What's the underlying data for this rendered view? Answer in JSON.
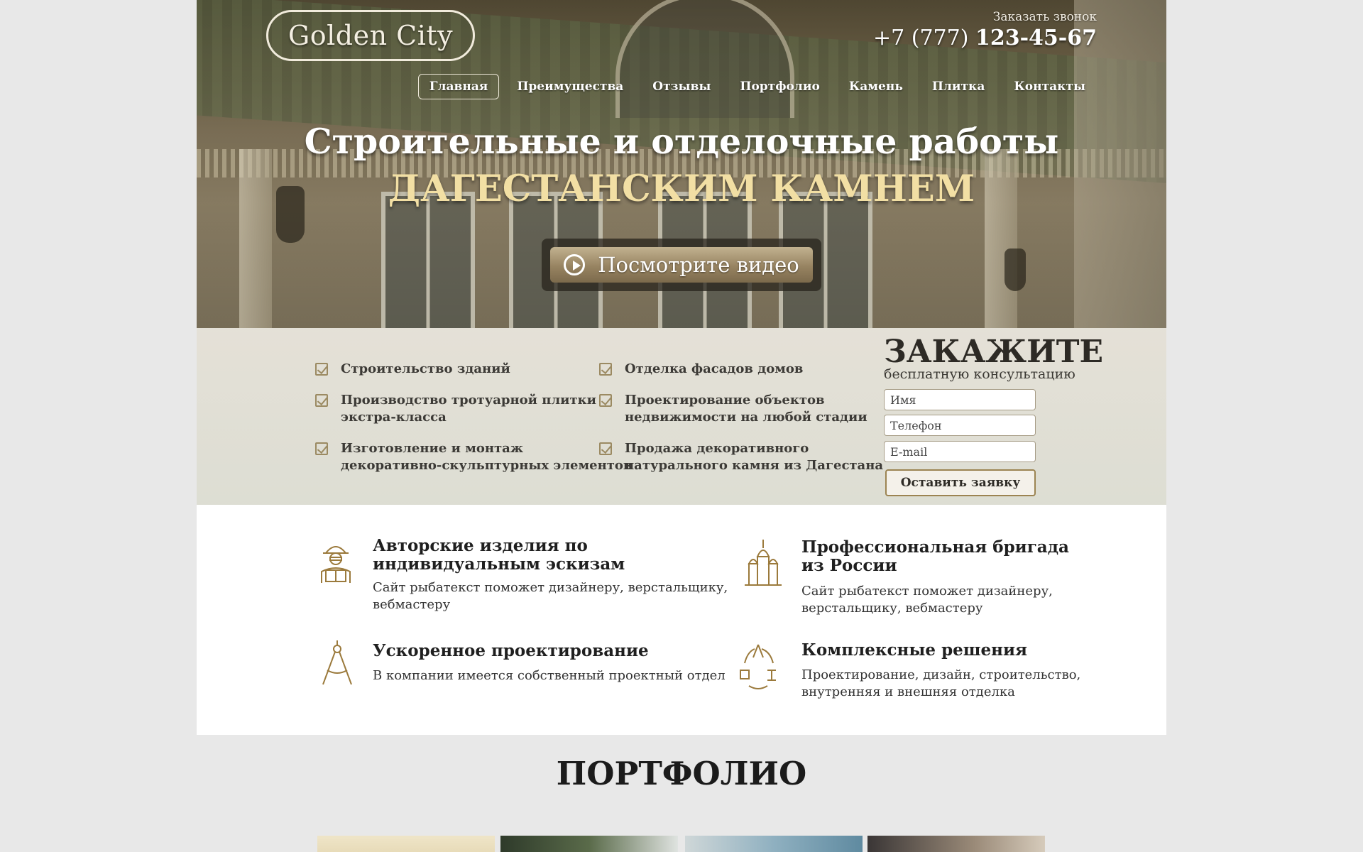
{
  "header": {
    "logo": "Golden City",
    "call_link": "Заказать звонок",
    "phone_code": "+7 (777)",
    "phone_number": "123-45-67"
  },
  "nav": {
    "items": [
      {
        "label": "Главная",
        "active": true
      },
      {
        "label": "Преимущества"
      },
      {
        "label": "Отзывы"
      },
      {
        "label": "Портфолио"
      },
      {
        "label": "Камень"
      },
      {
        "label": "Плитка"
      },
      {
        "label": "Контакты"
      }
    ]
  },
  "hero": {
    "title": "Строительные и отделочные работы",
    "subtitle": "ДАГЕСТАНСКИМ КАМНЕМ",
    "video_button": "Посмотрите видео"
  },
  "services": {
    "items": [
      {
        "line1": "Строительство зданий",
        "line2": ""
      },
      {
        "line1": "Отделка фасадов домов",
        "line2": ""
      },
      {
        "line1": "Производство тротуарной плитки",
        "line2": "экстра-класса"
      },
      {
        "line1": "Проектирование объектов",
        "line2": "недвижимости на любой стадии"
      },
      {
        "line1": "Изготовление и монтаж",
        "line2": "декоративно-скульптурных элементов"
      },
      {
        "line1": "Продажа декоративного",
        "line2": "натурального камня из Дагестана"
      }
    ]
  },
  "order_form": {
    "title": "ЗАКАЖИТЕ",
    "subtitle": "бесплатную консультацию",
    "name_placeholder": "Имя",
    "phone_placeholder": "Телефон",
    "email_placeholder": "E-mail",
    "submit_label": "Оставить заявку"
  },
  "features": {
    "items": [
      {
        "title_1": "Авторские изделия по",
        "title_2": "индивидуальным эскизам",
        "text_1": "Сайт рыбатекст поможет дизайнеру, верстальщику,",
        "text_2": "вебмастеру",
        "icon": "engineer-icon"
      },
      {
        "title_1": "Профессиональная бригада",
        "title_2": "из России",
        "text_1": "Сайт рыбатекст поможет дизайнеру,",
        "text_2": "верстальщику, вебмастеру",
        "icon": "cathedral-icon"
      },
      {
        "title_1": "Ускоренное проектирование",
        "title_2": "",
        "text_1": "В компании имеется собственный проектный отдел",
        "text_2": "",
        "icon": "compass-icon"
      },
      {
        "title_1": "Комплексные решения",
        "title_2": "",
        "text_1": "Проектирование, дизайн, строительство,",
        "text_2": "внутренняя и внешняя отделка",
        "icon": "cycle-icon"
      }
    ]
  },
  "portfolio": {
    "title": "ПОРТФОЛИО"
  },
  "colors": {
    "accent_gold": "#9b8a62",
    "hero_subtitle": "#f2dfa4",
    "page_bg": "#e8e8e8"
  }
}
